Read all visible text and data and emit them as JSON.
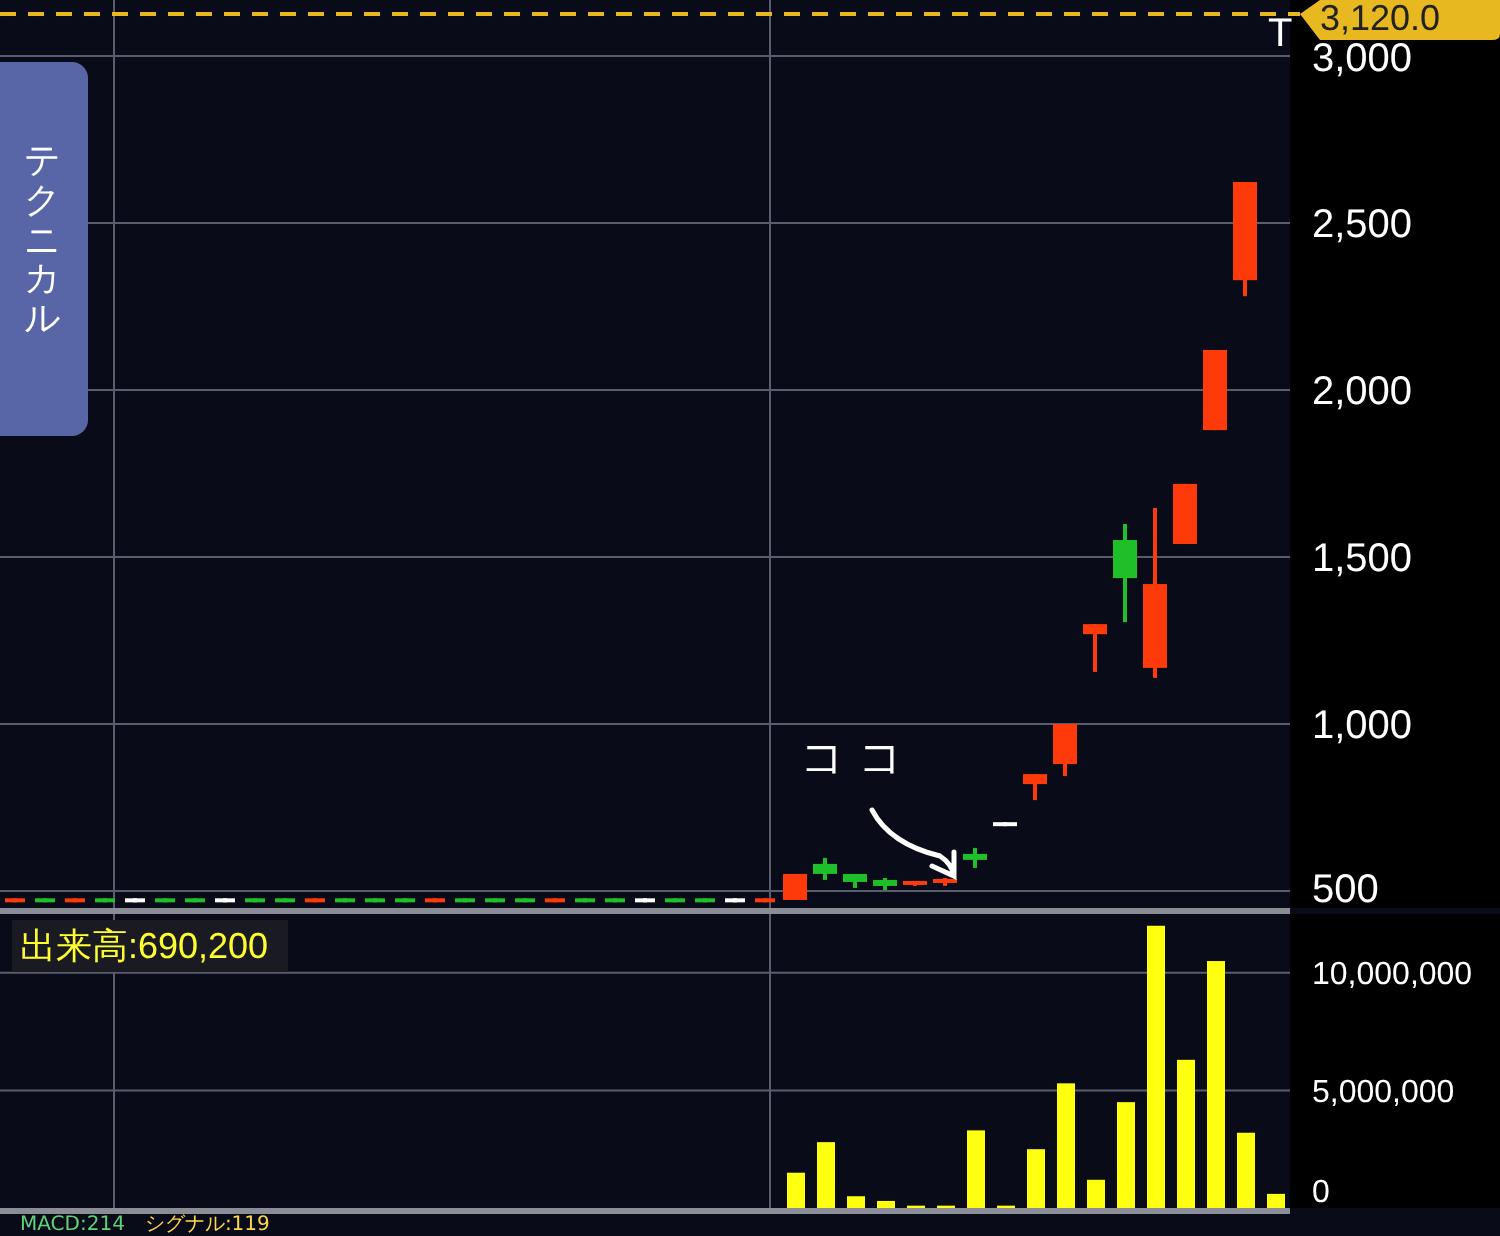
{
  "side_tab": {
    "label": "テクニカル"
  },
  "price_chart": {
    "price_badge": "3,120.0",
    "marker": "T",
    "chart_data": {
      "type": "candlestick",
      "grid": true,
      "categories": [
        null,
        null,
        null,
        null,
        null,
        null,
        null,
        null,
        null,
        null,
        null,
        null,
        null,
        null,
        null,
        null,
        null,
        null,
        null,
        null,
        null,
        null,
        null,
        null,
        null,
        null,
        null,
        null,
        null,
        null,
        null,
        null,
        null,
        null,
        null,
        null,
        null,
        null,
        null,
        null,
        null,
        null,
        null
      ],
      "ohlc": [
        [
          470,
          474,
          468,
          474
        ],
        [
          474,
          476,
          470,
          470
        ],
        [
          470,
          474,
          468,
          474
        ],
        [
          474,
          476,
          470,
          470
        ],
        [
          472,
          473,
          471,
          472
        ],
        [
          474,
          476,
          470,
          470
        ],
        [
          474,
          476,
          470,
          470
        ],
        [
          472,
          473,
          471,
          472
        ],
        [
          474,
          476,
          470,
          470
        ],
        [
          474,
          476,
          470,
          470
        ],
        [
          470,
          474,
          468,
          474
        ],
        [
          474,
          476,
          470,
          470
        ],
        [
          474,
          476,
          470,
          470
        ],
        [
          474,
          476,
          470,
          470
        ],
        [
          470,
          474,
          468,
          474
        ],
        [
          474,
          476,
          470,
          470
        ],
        [
          474,
          476,
          470,
          470
        ],
        [
          474,
          476,
          470,
          470
        ],
        [
          470,
          474,
          468,
          474
        ],
        [
          474,
          476,
          470,
          470
        ],
        [
          474,
          476,
          470,
          470
        ],
        [
          472,
          473,
          471,
          472
        ],
        [
          474,
          476,
          470,
          470
        ],
        [
          474,
          476,
          470,
          470
        ],
        [
          472,
          473,
          471,
          472
        ],
        [
          470,
          474,
          468,
          474
        ],
        [
          473,
          551,
          473,
          551
        ],
        [
          581,
          599,
          533,
          551
        ],
        [
          551,
          551,
          509,
          527
        ],
        [
          533,
          539,
          503,
          515
        ],
        [
          521,
          527,
          515,
          527
        ],
        [
          527,
          539,
          515,
          533
        ],
        [
          611,
          629,
          569,
          593
        ],
        [
          700,
          701,
          699,
          700
        ],
        [
          820,
          850,
          772,
          850
        ],
        [
          880,
          1000,
          844,
          1000
        ],
        [
          1269,
          1299,
          1156,
          1299
        ],
        [
          1551,
          1599,
          1305,
          1437
        ],
        [
          1168,
          1647,
          1138,
          1419
        ],
        [
          1539,
          1719,
          1539,
          1719
        ],
        [
          1880,
          2120,
          1880,
          2120
        ],
        [
          2329,
          2623,
          2281,
          2623
        ],
        null
      ],
      "ylim": [
        449,
        3168
      ],
      "yticks": [
        {
          "value": 3000,
          "label": "3,000"
        },
        {
          "value": 2500,
          "label": "2,500"
        },
        {
          "value": 2000,
          "label": "2,000"
        },
        {
          "value": 1500,
          "label": "1,500"
        },
        {
          "value": 1000,
          "label": "1,000"
        },
        {
          "value": 500,
          "label": "500"
        }
      ]
    }
  },
  "annotation": {
    "text": "コ コ"
  },
  "volume": {
    "label": "出来高:690,200",
    "chart_data": {
      "type": "bar",
      "grid": true,
      "categories": [
        null,
        null,
        null,
        null,
        null,
        null,
        null,
        null,
        null,
        null,
        null,
        null,
        null,
        null,
        null,
        null,
        null,
        null,
        null,
        null,
        null,
        null,
        null,
        null,
        null,
        null,
        null,
        null,
        null,
        null,
        null,
        null,
        null,
        null,
        null,
        null,
        null,
        null,
        null,
        null,
        null,
        null,
        null
      ],
      "values": [
        0,
        0,
        0,
        0,
        0,
        0,
        0,
        0,
        0,
        0,
        0,
        0,
        0,
        0,
        0,
        0,
        0,
        0,
        0,
        0,
        0,
        0,
        0,
        0,
        0,
        0,
        1500000,
        2800000,
        500000,
        300000,
        100000,
        100000,
        3300000,
        100000,
        2500000,
        5300000,
        1200000,
        4500000,
        12000000,
        6300000,
        10500000,
        3200000,
        600000
      ],
      "ylim": [
        0,
        12500000
      ],
      "yticks": [
        {
          "value": 0,
          "label": "0"
        },
        {
          "value": 5000000,
          "label": "5,000,000"
        },
        {
          "value": 10000000,
          "label": "10,000,000"
        }
      ]
    }
  },
  "macd": {
    "macd_label": "MACD:214",
    "signal_label": "シグナル:119"
  }
}
